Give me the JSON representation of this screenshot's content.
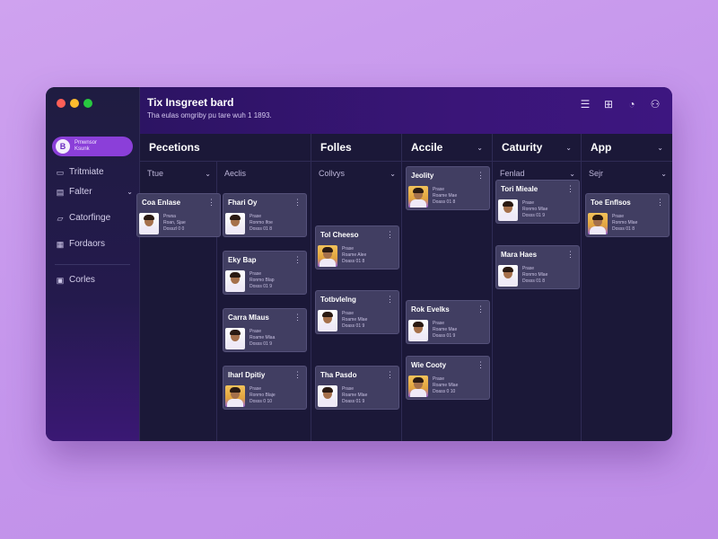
{
  "app": {
    "title": "Tix Insgreet bard",
    "subtitle": "Tha eulas omgriby pu tare wuh 1 1893."
  },
  "header_icons": [
    "list-icon",
    "gift-icon",
    "clock-icon",
    "user-icon"
  ],
  "sidebar": {
    "active": {
      "badge": "B",
      "line1": "Pmwnsor",
      "line2": "Ksunk"
    },
    "items": [
      {
        "label": "Tritmiate",
        "icon": "table-icon"
      },
      {
        "label": "Falter",
        "icon": "filter-icon",
        "has_chevron": true
      },
      {
        "label": "Catorfinge",
        "icon": "folder-icon"
      },
      {
        "label": "Fordaors",
        "icon": "grid-icon"
      },
      {
        "label": "Corles",
        "icon": "copy-icon"
      }
    ]
  },
  "groups": [
    {
      "label": "Pecetions"
    },
    {
      "label": "Folles"
    },
    {
      "label": "Accile",
      "has_chevron": true
    },
    {
      "label": "Caturity",
      "has_chevron": true
    },
    {
      "label": "App",
      "has_chevron": true
    }
  ],
  "columns": [
    {
      "label": "Ttue",
      "cards": [
        {
          "name": "Coa Enlase",
          "l1": "Prwsa",
          "l2": "Roan, Sjae",
          "l3": "Dosszl 0 0",
          "avatar": "white"
        }
      ]
    },
    {
      "label": "Aeclis",
      "cards": [
        {
          "name": "Fhari Oy",
          "l1": "Prase",
          "l2": "Ronmo Ifoe",
          "l3": "Dosss 01 8",
          "avatar": "white"
        },
        {
          "name": "Eky Bap",
          "l1": "Prase",
          "l2": "Ronmo Blap",
          "l3": "Dosss 01 9",
          "avatar": "white"
        },
        {
          "name": "Carra Mlaus",
          "l1": "Prase",
          "l2": "Roame Mlaa",
          "l3": "Dosss 01 9",
          "avatar": "white"
        },
        {
          "name": "Iharl Dpitiy",
          "l1": "Prase",
          "l2": "Ronmo Blaje",
          "l3": "Dosss 0 10",
          "avatar": "gold"
        }
      ]
    },
    {
      "label": "Collvys",
      "cards": [
        {
          "name": "Tol Cheeso",
          "l1": "Prase",
          "l2": "Roame Alee",
          "l3": "Doass 01 8",
          "avatar": "gold"
        },
        {
          "name": "Totbvlelng",
          "l1": "Prase",
          "l2": "Roame Mlae",
          "l3": "Doass 01 9",
          "avatar": "white"
        },
        {
          "name": "Tha Pasdo",
          "l1": "Prase",
          "l2": "Roame Mlae",
          "l3": "Doass 01 9",
          "avatar": "white"
        }
      ]
    },
    {
      "label": "",
      "cards": [
        {
          "name": "Jeolity",
          "l1": "Prase",
          "l2": "Roame Mae",
          "l3": "Doass 01 8",
          "avatar": "gold"
        },
        {
          "name": "Rok Evelks",
          "l1": "Prase",
          "l2": "Roame Mae",
          "l3": "Doass 01 9",
          "avatar": "white"
        },
        {
          "name": "Wie Cooty",
          "l1": "Prase",
          "l2": "Roame Mlae",
          "l3": "Doass 0 10",
          "avatar": "gold"
        }
      ]
    },
    {
      "label": "Fenlad",
      "cards": [
        {
          "name": "Tori Mieale",
          "l1": "Prase",
          "l2": "Ronmo Mlae",
          "l3": "Dosss 01 9",
          "avatar": "white"
        },
        {
          "name": "Mara Haes",
          "l1": "Prase",
          "l2": "Ronmo Mlae",
          "l3": "Dosss 01 8",
          "avatar": "white"
        }
      ]
    },
    {
      "label": "Sejr",
      "cards": [
        {
          "name": "Toe Enflsos",
          "l1": "Prase",
          "l2": "Ronmo Mlae",
          "l3": "Dosss 01 8",
          "avatar": "gold"
        }
      ]
    }
  ]
}
